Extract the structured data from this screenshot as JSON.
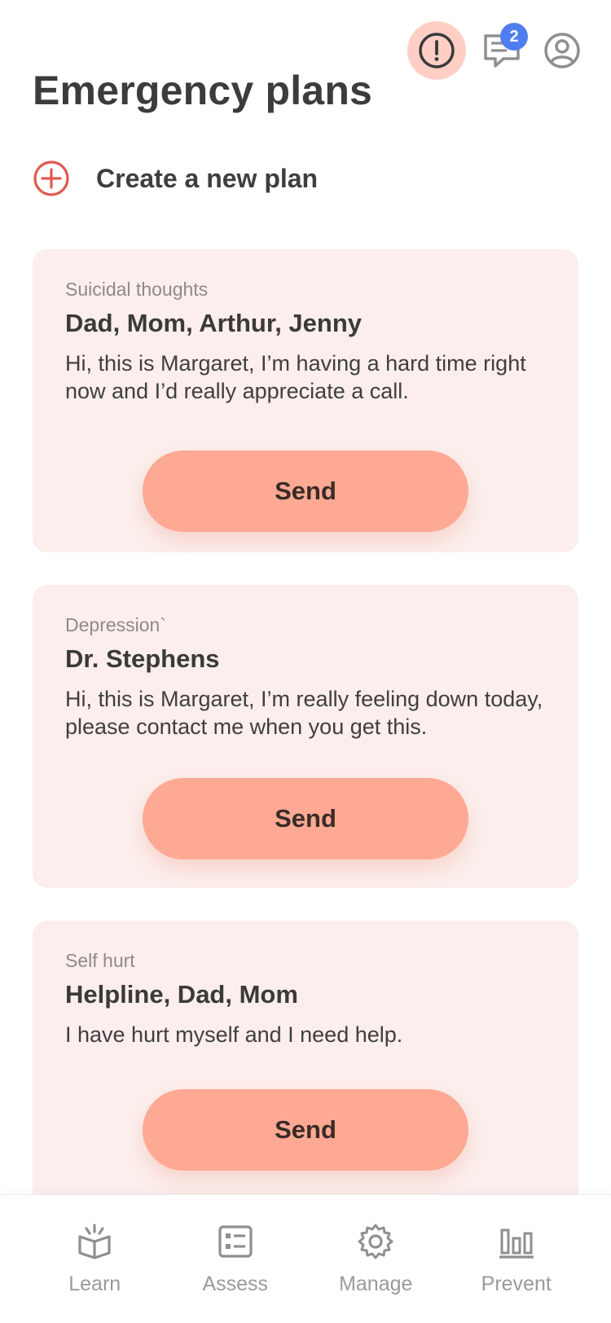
{
  "header": {
    "title": "Emergency plans",
    "messages_badge": "2",
    "alert_color": "#ffcfc6",
    "badge_color": "#4f7df0"
  },
  "create": {
    "label": "Create a new plan",
    "icon": "plus-circle-icon",
    "icon_color": "#e05a4f"
  },
  "plans": [
    {
      "category": "Suicidal thoughts",
      "contacts": "Dad, Mom, Arthur, Jenny",
      "message": "Hi, this is Margaret, I’m having a hard time right now and I’d really appreciate a call.",
      "send_label": "Send"
    },
    {
      "category": "Depression`",
      "contacts": "Dr. Stephens",
      "message": "Hi, this is Margaret, I’m really feeling down today, please contact me when you get this.",
      "send_label": "Send"
    },
    {
      "category": "Self hurt",
      "contacts": "Helpline, Dad, Mom",
      "message": "I have hurt myself and I need help.",
      "send_label": "Send"
    }
  ],
  "nav": [
    {
      "label": "Learn",
      "icon": "book-icon"
    },
    {
      "label": "Assess",
      "icon": "checklist-icon"
    },
    {
      "label": "Manage",
      "icon": "gear-icon"
    },
    {
      "label": "Prevent",
      "icon": "bar-chart-icon"
    }
  ],
  "colors": {
    "card_bg": "#fbeeec",
    "send_button": "#fea994"
  }
}
